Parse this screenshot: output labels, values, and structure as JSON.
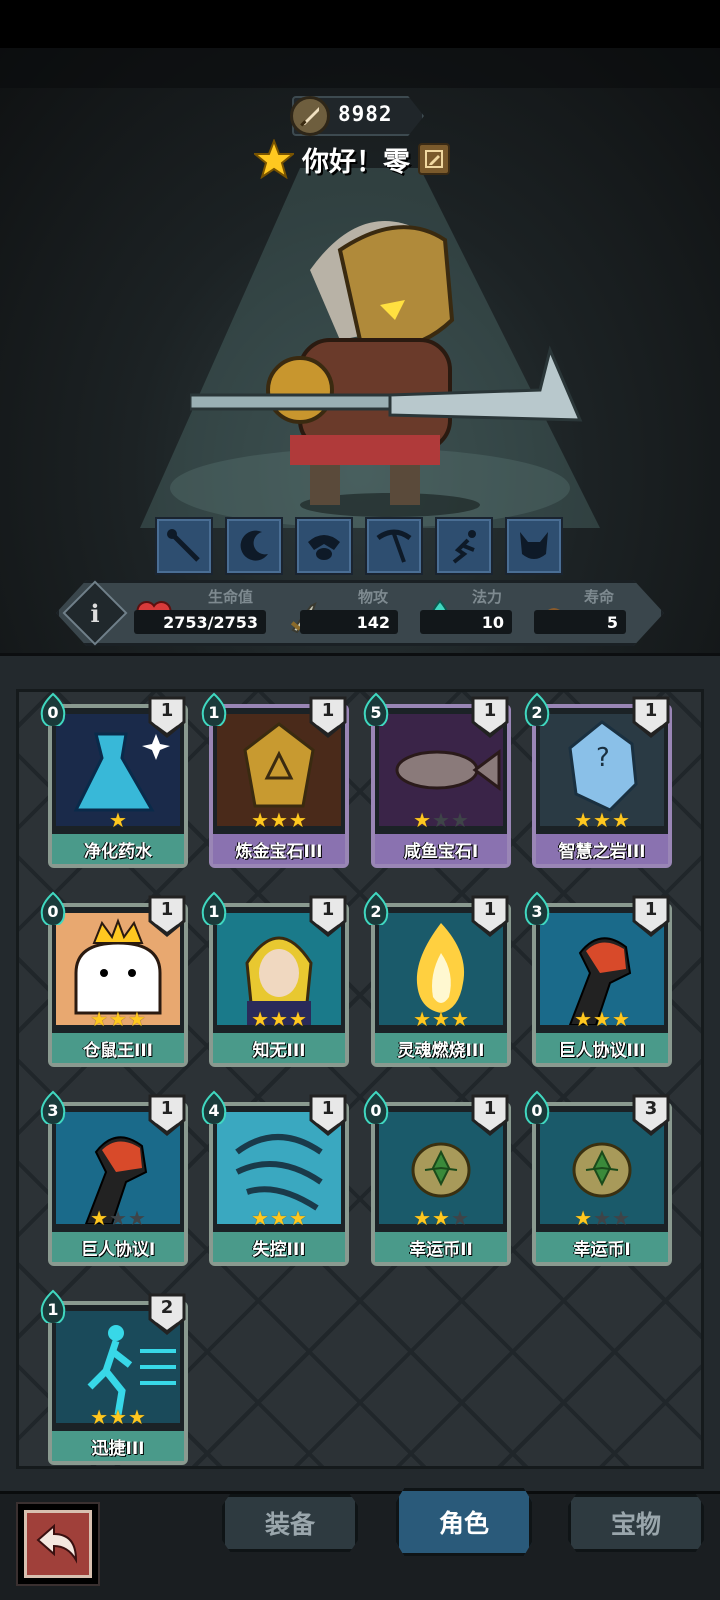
{
  "header": {
    "power_value": "8982",
    "greeting": "你好！零"
  },
  "hero": {
    "skills": [
      "staff-skill-icon",
      "crescent-skill-icon",
      "ram-skill-icon",
      "pickaxe-skill-icon",
      "dash-skill-icon",
      "demon-skill-icon"
    ]
  },
  "stats": {
    "info_label": "i",
    "hp_label": "生命值",
    "hp_value": "2753/2753",
    "atk_label": "物攻",
    "atk_value": "142",
    "mana_label": "法力",
    "mana_value": "10",
    "life_label": "寿命",
    "life_value": "5"
  },
  "cards": [
    {
      "name": "净化药水",
      "cost": "0",
      "level": "1",
      "stars": 1,
      "max_stars": 1,
      "theme": "green",
      "art": "potion"
    },
    {
      "name": "炼金宝石III",
      "cost": "1",
      "level": "1",
      "stars": 3,
      "max_stars": 3,
      "theme": "purple",
      "art": "gold-gem"
    },
    {
      "name": "咸鱼宝石I",
      "cost": "5",
      "level": "1",
      "stars": 1,
      "max_stars": 3,
      "theme": "purple",
      "art": "fish"
    },
    {
      "name": "智慧之岩III",
      "cost": "2",
      "level": "1",
      "stars": 3,
      "max_stars": 3,
      "theme": "purple",
      "art": "crystal"
    },
    {
      "name": "仓鼠王III",
      "cost": "0",
      "level": "1",
      "stars": 3,
      "max_stars": 3,
      "theme": "green",
      "art": "hamster"
    },
    {
      "name": "知无III",
      "cost": "1",
      "level": "1",
      "stars": 3,
      "max_stars": 3,
      "theme": "green",
      "art": "blonde"
    },
    {
      "name": "灵魂燃烧III",
      "cost": "2",
      "level": "1",
      "stars": 3,
      "max_stars": 3,
      "theme": "green",
      "art": "fire"
    },
    {
      "name": "巨人协议III",
      "cost": "3",
      "level": "1",
      "stars": 3,
      "max_stars": 3,
      "theme": "green",
      "art": "fist"
    },
    {
      "name": "巨人协议I",
      "cost": "3",
      "level": "1",
      "stars": 1,
      "max_stars": 3,
      "theme": "green",
      "art": "fist"
    },
    {
      "name": "失控III",
      "cost": "4",
      "level": "1",
      "stars": 3,
      "max_stars": 3,
      "theme": "green",
      "art": "claw"
    },
    {
      "name": "幸运币II",
      "cost": "0",
      "level": "1",
      "stars": 2,
      "max_stars": 3,
      "theme": "green",
      "art": "coin"
    },
    {
      "name": "幸运币I",
      "cost": "0",
      "level": "3",
      "stars": 1,
      "max_stars": 3,
      "theme": "green",
      "art": "coin"
    },
    {
      "name": "迅捷III",
      "cost": "1",
      "level": "2",
      "stars": 3,
      "max_stars": 3,
      "theme": "green",
      "art": "runner"
    }
  ],
  "nav": {
    "tabs": [
      {
        "label": "装备",
        "active": false
      },
      {
        "label": "角色",
        "active": true
      },
      {
        "label": "宝物",
        "active": false
      }
    ]
  },
  "colors": {
    "star_on": "#ffc820",
    "mana": "#40d8c0",
    "active_tab": "#2a5a7a"
  }
}
